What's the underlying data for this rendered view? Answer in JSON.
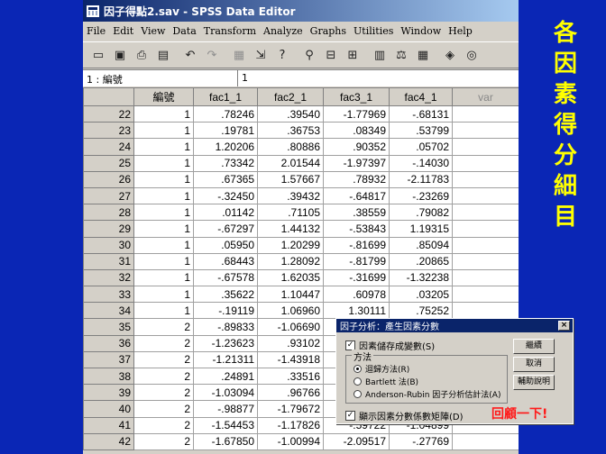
{
  "window": {
    "title": "因子得點2.sav - SPSS Data Editor"
  },
  "menu": [
    "File",
    "Edit",
    "View",
    "Data",
    "Transform",
    "Analyze",
    "Graphs",
    "Utilities",
    "Window",
    "Help"
  ],
  "cell_editor": {
    "ref": "1 : 編號",
    "value": "1"
  },
  "columns": [
    "編號",
    "fac1_1",
    "fac2_1",
    "fac3_1",
    "fac4_1",
    "var"
  ],
  "rows": [
    {
      "n": "22",
      "v": [
        "1",
        ".78246",
        ".39540",
        "-1.77969",
        "-.68131"
      ]
    },
    {
      "n": "23",
      "v": [
        "1",
        ".19781",
        ".36753",
        ".08349",
        ".53799"
      ]
    },
    {
      "n": "24",
      "v": [
        "1",
        "1.20206",
        ".80886",
        ".90352",
        ".05702"
      ]
    },
    {
      "n": "25",
      "v": [
        "1",
        ".73342",
        "2.01544",
        "-1.97397",
        "-.14030"
      ]
    },
    {
      "n": "26",
      "v": [
        "1",
        ".67365",
        "1.57667",
        ".78932",
        "-2.11783"
      ]
    },
    {
      "n": "27",
      "v": [
        "1",
        "-.32450",
        ".39432",
        "-.64817",
        "-.23269"
      ]
    },
    {
      "n": "28",
      "v": [
        "1",
        ".01142",
        ".71105",
        ".38559",
        ".79082"
      ]
    },
    {
      "n": "29",
      "v": [
        "1",
        "-.67297",
        "1.44132",
        "-.53843",
        "1.19315"
      ]
    },
    {
      "n": "30",
      "v": [
        "1",
        ".05950",
        "1.20299",
        "-.81699",
        ".85094"
      ]
    },
    {
      "n": "31",
      "v": [
        "1",
        ".68443",
        "1.28092",
        "-.81799",
        ".20865"
      ]
    },
    {
      "n": "32",
      "v": [
        "1",
        "-.67578",
        "1.62035",
        "-.31699",
        "-1.32238"
      ]
    },
    {
      "n": "33",
      "v": [
        "1",
        ".35622",
        "1.10447",
        ".60978",
        ".03205"
      ]
    },
    {
      "n": "34",
      "v": [
        "1",
        "-.19119",
        "1.06960",
        "1.30111",
        ".75252"
      ]
    },
    {
      "n": "35",
      "v": [
        "2",
        "-.89833",
        "-1.06690",
        "",
        ""
      ]
    },
    {
      "n": "36",
      "v": [
        "2",
        "-1.23623",
        ".93102",
        "",
        ""
      ]
    },
    {
      "n": "37",
      "v": [
        "2",
        "-1.21311",
        "-1.43918",
        "",
        ""
      ]
    },
    {
      "n": "38",
      "v": [
        "2",
        ".24891",
        ".33516",
        "",
        ""
      ]
    },
    {
      "n": "39",
      "v": [
        "2",
        "-1.03094",
        ".96766",
        "",
        ""
      ]
    },
    {
      "n": "40",
      "v": [
        "2",
        "-.98877",
        "-1.79672",
        "",
        ""
      ]
    },
    {
      "n": "41",
      "v": [
        "2",
        "-1.54453",
        "-1.17826",
        "-.59722",
        "-1.04899"
      ]
    },
    {
      "n": "42",
      "v": [
        "2",
        "-1.67850",
        "-1.00994",
        "-2.09517",
        "-.27769"
      ]
    }
  ],
  "side_title": [
    "各",
    "因",
    "素",
    "得",
    "分",
    "細",
    "目"
  ],
  "dialog": {
    "title": "因子分析：產生因素分數",
    "save_as_vars": "因素儲存成變數(S)",
    "method_label": "方法",
    "methods": [
      "迴歸方法(R)",
      "Bartlett 法(B)",
      "Anderson-Rubin 因子分析估計法(A)"
    ],
    "show_matrix": "顯示因素分數係數矩陣(D)",
    "buttons": [
      "繼續",
      "取消",
      "輔助說明"
    ]
  },
  "back_link": "回顧一下!"
}
